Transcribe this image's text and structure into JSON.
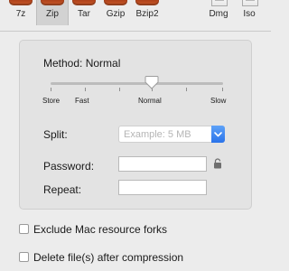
{
  "toolbar": {
    "formats": [
      {
        "label": "7z",
        "icon": "archive-icon",
        "selected": false
      },
      {
        "label": "Zip",
        "icon": "archive-icon",
        "selected": true
      },
      {
        "label": "Tar",
        "icon": "archive-icon",
        "selected": false
      },
      {
        "label": "Gzip",
        "icon": "archive-icon",
        "selected": false
      },
      {
        "label": "Bzip2",
        "icon": "archive-icon",
        "selected": false
      },
      {
        "label": "Dmg",
        "icon": "disk-image-icon",
        "selected": false
      },
      {
        "label": "Iso",
        "icon": "disk-image-icon",
        "selected": false
      }
    ]
  },
  "method": {
    "label": "Method: Normal",
    "levels": [
      "Store",
      "Fast",
      "Normal",
      "Slow"
    ],
    "selected_level": "Normal"
  },
  "split": {
    "label": "Split:",
    "placeholder": "Example: 5 MB",
    "value": "",
    "dropdown_icon": "chevron-down-icon"
  },
  "password": {
    "label": "Password:",
    "value": "",
    "icon": "lock-icon"
  },
  "repeat": {
    "label": "Repeat:",
    "value": ""
  },
  "options": {
    "exclude_forks": {
      "label": "Exclude Mac resource forks",
      "checked": false
    },
    "delete_after": {
      "label": "Delete file(s) after compression",
      "checked": false
    }
  },
  "colors": {
    "archive_icon": "#b0441c",
    "accent": "#2a73ea",
    "window_bg": "#ececec"
  }
}
